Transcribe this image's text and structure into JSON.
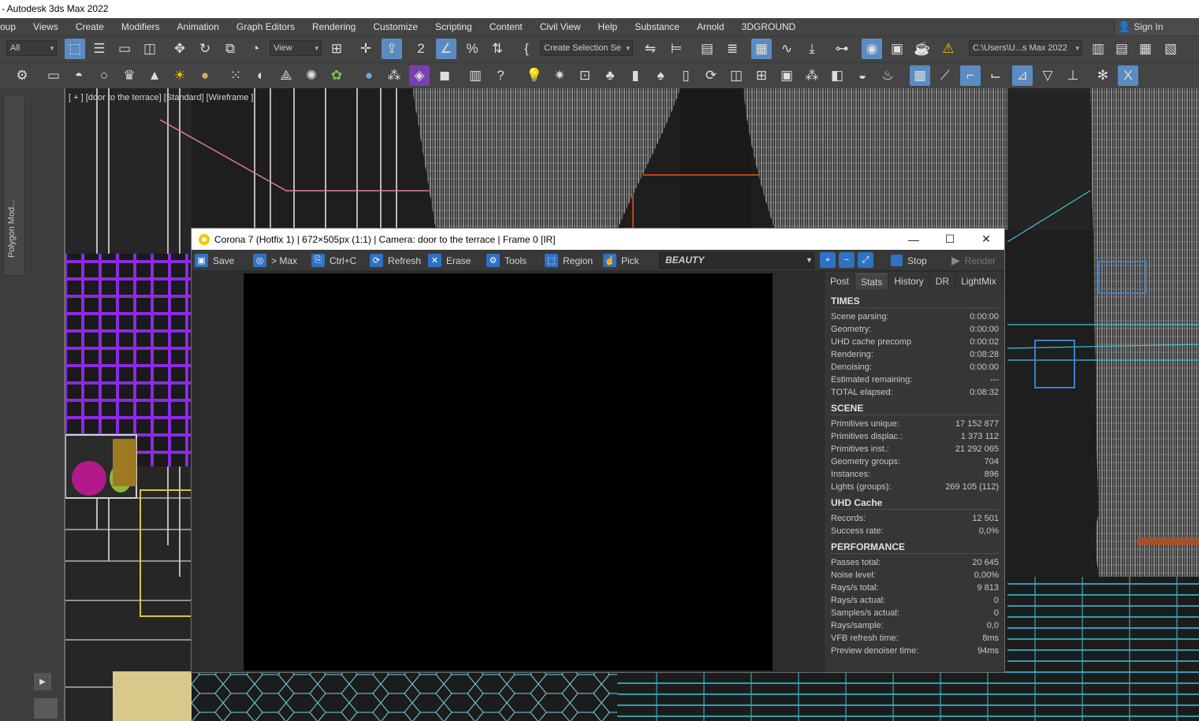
{
  "window_title": "- Autodesk 3ds Max 2022",
  "menu": [
    "oup",
    "Views",
    "Create",
    "Modifiers",
    "Animation",
    "Graph Editors",
    "Rendering",
    "Customize",
    "Scripting",
    "Content",
    "Civil View",
    "Help",
    "Substance",
    "Arnold",
    "3DGROUND"
  ],
  "sign_in": "Sign In",
  "toolbar1": {
    "filter_value": "All",
    "coord_value": "View",
    "selection_set_placeholder": "Create Selection Se",
    "project_path": "C:\\Users\\U...s Max 2022"
  },
  "left_panel": {
    "label": "Polygon Mod..."
  },
  "viewport": {
    "label": "[ + ] [door to the terrace] [Standard] [Wireframe ]"
  },
  "vfb": {
    "title": "Corona 7 (Hotfix 1) | 672×505px (1:1) | Camera: door to the terrace | Frame 0 [IR]",
    "toolbar": {
      "save": "Save",
      "to_max": "> Max",
      "copy": "Ctrl+C",
      "refresh": "Refresh",
      "erase": "Erase",
      "tools": "Tools",
      "region": "Region",
      "pick": "Pick",
      "channel": "BEAUTY",
      "stop": "Stop",
      "render": "Render"
    },
    "tabs": [
      "Post",
      "Stats",
      "History",
      "DR",
      "LightMix"
    ],
    "selected_tab": "Stats",
    "stats": [
      {
        "title": "TIMES",
        "rows": [
          {
            "label": "Scene parsing:",
            "value": "0:00:00"
          },
          {
            "label": "Geometry:",
            "value": "0:00:00"
          },
          {
            "label": "UHD cache precomp",
            "value": "0:00:02"
          },
          {
            "label": "Rendering:",
            "value": "0:08:28"
          },
          {
            "label": "Denoising:",
            "value": "0:00:00"
          },
          {
            "label": "Estimated remaining:",
            "value": "---"
          },
          {
            "label": "TOTAL elapsed:",
            "value": "0:08:32"
          }
        ]
      },
      {
        "title": "SCENE",
        "rows": [
          {
            "label": "Primitives unique:",
            "value": "17 152 877"
          },
          {
            "label": "Primitives displac.:",
            "value": "1 373 112"
          },
          {
            "label": "Primitives inst.:",
            "value": "21 292 065"
          },
          {
            "label": "Geometry groups:",
            "value": "704"
          },
          {
            "label": "Instances:",
            "value": "896"
          },
          {
            "label": "Lights (groups):",
            "value": "269 105 (112)"
          }
        ]
      },
      {
        "title": "UHD Cache",
        "rows": [
          {
            "label": "Records:",
            "value": "12 501"
          },
          {
            "label": "Success rate:",
            "value": "0,0%"
          }
        ]
      },
      {
        "title": "PERFORMANCE",
        "rows": [
          {
            "label": "Passes total:",
            "value": "20 645"
          },
          {
            "label": "Noise level:",
            "value": "0,00%"
          },
          {
            "label": "Rays/s total:",
            "value": "9 813"
          },
          {
            "label": "Rays/s actual:",
            "value": "0"
          },
          {
            "label": "Samples/s actual:",
            "value": "0"
          },
          {
            "label": "Rays/sample:",
            "value": "0,0"
          },
          {
            "label": "VFB refresh time:",
            "value": "8ms"
          },
          {
            "label": "Preview denoiser time:",
            "value": "94ms"
          }
        ]
      }
    ]
  },
  "colors": {
    "accent": "#2f72c4",
    "active_tool": "#5a8cc2",
    "ui_bg": "#444444",
    "vfb_bg": "#2d2d2d"
  }
}
